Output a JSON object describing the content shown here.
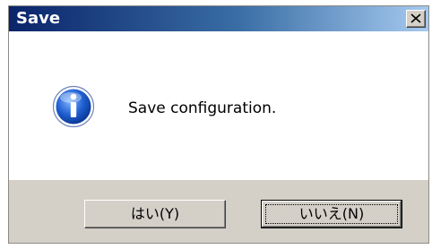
{
  "window": {
    "title": "Save",
    "close_icon": "close-icon"
  },
  "dialog": {
    "icon": "info-icon",
    "message": "Save configuration."
  },
  "buttons": {
    "yes_label": "はい(Y)",
    "no_label": "いいえ(N)"
  },
  "colors": {
    "titlebar_start": "#0a246a",
    "titlebar_end": "#a6caf0",
    "dialog_face": "#d4d0c8",
    "content_bg": "#ffffff"
  }
}
